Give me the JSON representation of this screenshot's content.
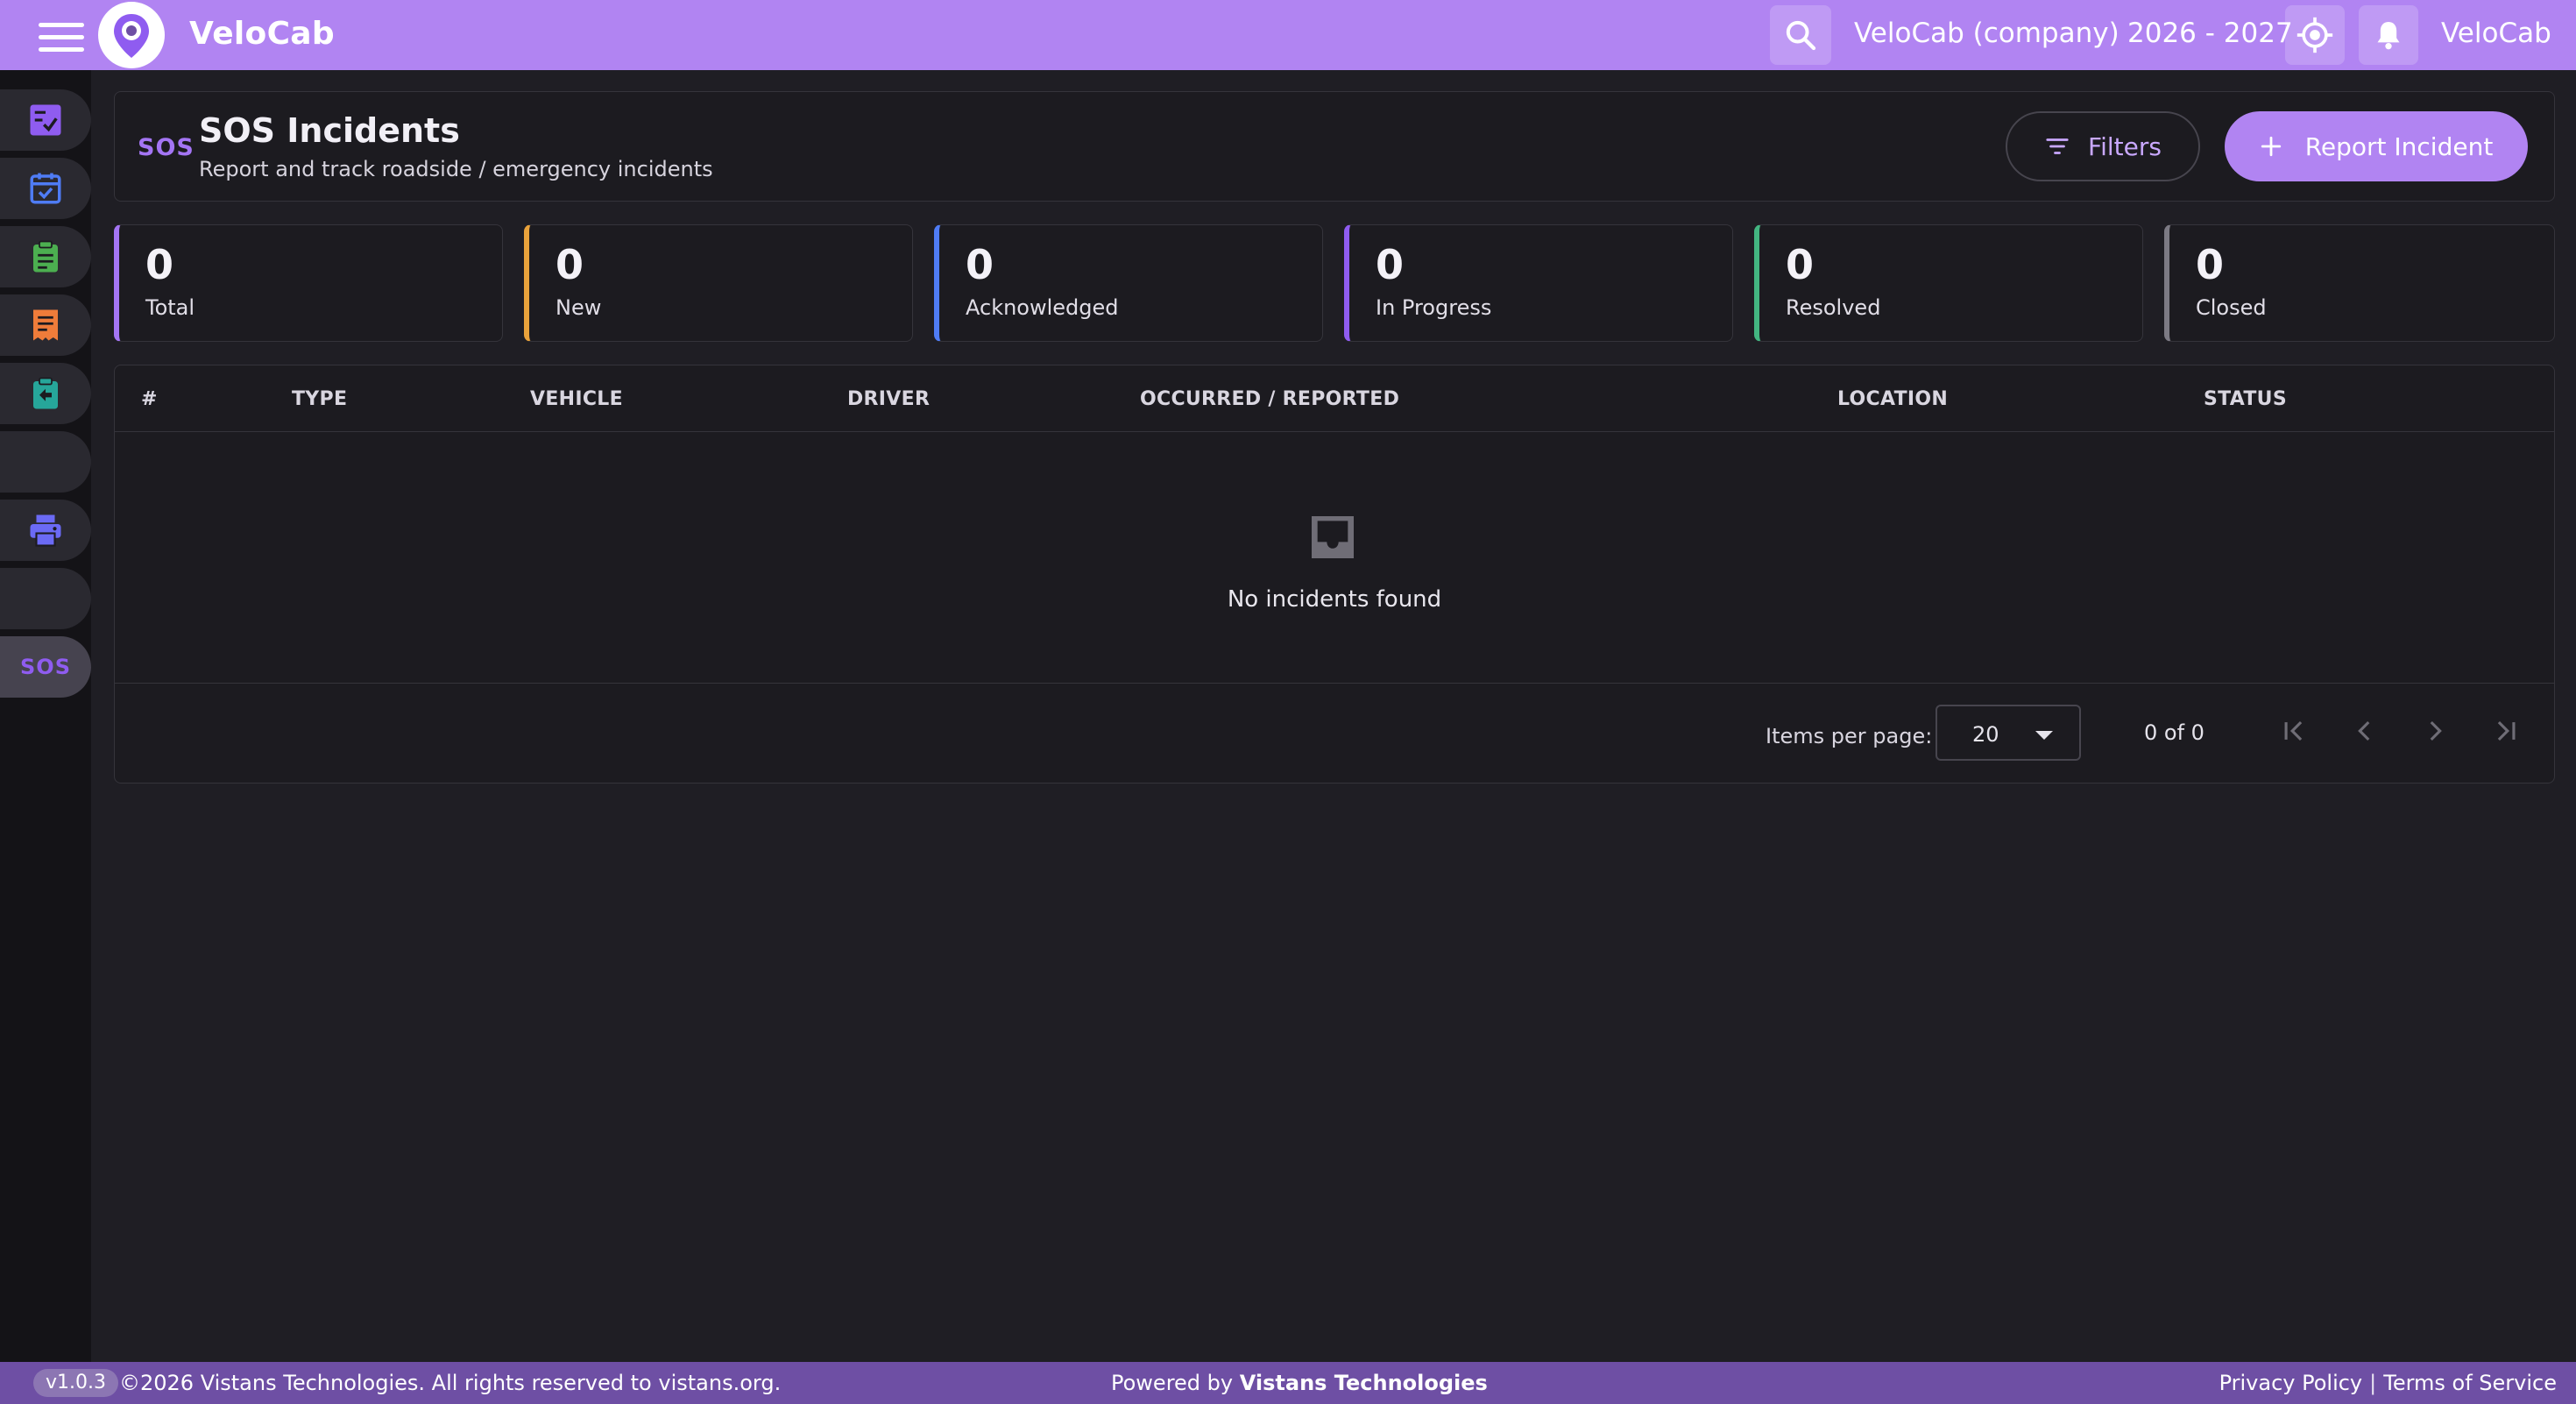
{
  "topbar": {
    "app_title": "VeloCab",
    "company": "VeloCab (company)",
    "year_range": "2026 - 2027",
    "user_name": "VeloCab",
    "icons": [
      "menu-icon",
      "logo-icon",
      "search-icon",
      "location-target-icon",
      "bell-icon"
    ]
  },
  "sidebar": {
    "items": [
      {
        "icon": "checklist-icon",
        "color": "#8f5cf0"
      },
      {
        "icon": "calendar-check-icon",
        "color": "#4f7cf5"
      },
      {
        "icon": "clipboard-icon",
        "color": "#4caf50"
      },
      {
        "icon": "receipt-icon",
        "color": "#ef7c3a"
      },
      {
        "icon": "clipboard-return-icon",
        "color": "#26a69a"
      },
      {
        "icon": "",
        "color": ""
      },
      {
        "icon": "printer-icon",
        "color": "#6b6af5"
      },
      {
        "icon": "",
        "color": ""
      },
      {
        "label": "SOS",
        "color": "#8f5cf0",
        "active": true
      }
    ]
  },
  "header": {
    "badge": "SOS",
    "title": "SOS Incidents",
    "subtitle": "Report and track roadside / emergency incidents",
    "filters_label": "Filters",
    "report_label": "Report Incident"
  },
  "stats": [
    {
      "value": "0",
      "label": "Total",
      "color": "#a475f4"
    },
    {
      "value": "0",
      "label": "New",
      "color": "#e9a23b"
    },
    {
      "value": "0",
      "label": "Acknowledged",
      "color": "#4f7cf5"
    },
    {
      "value": "0",
      "label": "In Progress",
      "color": "#8f5cf0"
    },
    {
      "value": "0",
      "label": "Resolved",
      "color": "#43b581"
    },
    {
      "value": "0",
      "label": "Closed",
      "color": "#7c7a84"
    }
  ],
  "table": {
    "columns": [
      "#",
      "TYPE",
      "VEHICLE",
      "DRIVER",
      "OCCURRED / REPORTED",
      "LOCATION",
      "STATUS"
    ],
    "rows": [],
    "empty_text": "No incidents found",
    "paginator": {
      "items_per_page_label": "Items per page:",
      "items_per_page": "20",
      "range_label": "0 of 0"
    }
  },
  "footer": {
    "version": "v1.0.3",
    "copyright": "©2026 Vistans Technologies. All rights reserved to vistans.org.",
    "powered_prefix": "Powered by",
    "powered_company": "Vistans Technologies",
    "privacy": "Privacy Policy",
    "separator": "|",
    "terms": "Terms of Service"
  },
  "colors": {
    "topbar": "#b184f2",
    "accent": "#b184f2",
    "footer": "#6e4fa4",
    "background": "#1f1e24"
  }
}
